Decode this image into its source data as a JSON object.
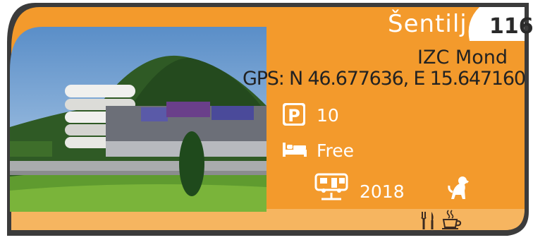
{
  "location": {
    "place": "Šentilj",
    "number": "116",
    "site_name": "IZC Mond",
    "gps": "GPS: N 46.677636, E 15.647160"
  },
  "details": {
    "parking": "10",
    "overnight": "Free",
    "year": "2018"
  },
  "icons": {
    "parking": "parking-icon",
    "bed": "bed-icon",
    "camper_service": "camper-service-icon",
    "dog": "dog-allowed-icon",
    "restaurant": "restaurant-icon",
    "cafe": "coffee-cup-icon"
  },
  "colors": {
    "orange": "#f39a2c",
    "light_orange": "#f6b560",
    "dark_gray": "#3b3b3b"
  }
}
